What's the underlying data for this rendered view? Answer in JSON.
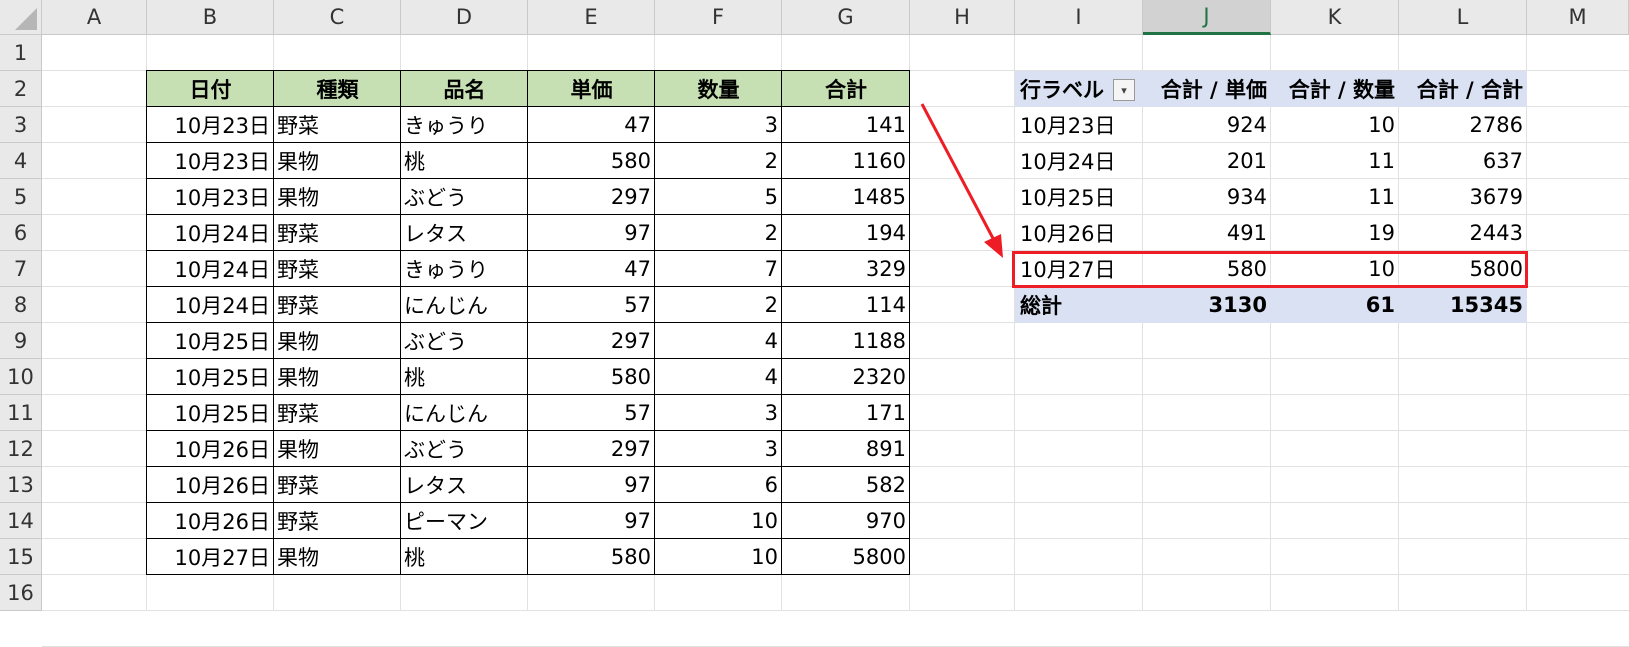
{
  "columns": [
    "A",
    "B",
    "C",
    "D",
    "E",
    "F",
    "G",
    "H",
    "I",
    "J",
    "K",
    "L",
    "M"
  ],
  "selected_column": "J",
  "rows": [
    "1",
    "2",
    "3",
    "4",
    "5",
    "6",
    "7",
    "8",
    "9",
    "10",
    "11",
    "12",
    "13",
    "14",
    "15",
    "16"
  ],
  "source_table": {
    "headers": [
      "日付",
      "種類",
      "品名",
      "単価",
      "数量",
      "合計"
    ],
    "rows": [
      [
        "10月23日",
        "野菜",
        "きゅうり",
        "47",
        "3",
        "141"
      ],
      [
        "10月23日",
        "果物",
        "桃",
        "580",
        "2",
        "1160"
      ],
      [
        "10月23日",
        "果物",
        "ぶどう",
        "297",
        "5",
        "1485"
      ],
      [
        "10月24日",
        "野菜",
        "レタス",
        "97",
        "2",
        "194"
      ],
      [
        "10月24日",
        "野菜",
        "きゅうり",
        "47",
        "7",
        "329"
      ],
      [
        "10月24日",
        "野菜",
        "にんじん",
        "57",
        "2",
        "114"
      ],
      [
        "10月25日",
        "果物",
        "ぶどう",
        "297",
        "4",
        "1188"
      ],
      [
        "10月25日",
        "果物",
        "桃",
        "580",
        "4",
        "2320"
      ],
      [
        "10月25日",
        "野菜",
        "にんじん",
        "57",
        "3",
        "171"
      ],
      [
        "10月26日",
        "果物",
        "ぶどう",
        "297",
        "3",
        "891"
      ],
      [
        "10月26日",
        "野菜",
        "レタス",
        "97",
        "6",
        "582"
      ],
      [
        "10月26日",
        "野菜",
        "ピーマン",
        "97",
        "10",
        "970"
      ],
      [
        "10月27日",
        "果物",
        "桃",
        "580",
        "10",
        "5800"
      ]
    ]
  },
  "pivot_table": {
    "headers": [
      "行ラベル",
      "合計 / 単価",
      "合計 / 数量",
      "合計 / 合計"
    ],
    "filter_icon": "dropdown-arrow-icon",
    "rows": [
      [
        "10月23日",
        "924",
        "10",
        "2786"
      ],
      [
        "10月24日",
        "201",
        "11",
        "637"
      ],
      [
        "10月25日",
        "934",
        "11",
        "3679"
      ],
      [
        "10月26日",
        "491",
        "19",
        "2443"
      ],
      [
        "10月27日",
        "580",
        "10",
        "5800"
      ]
    ],
    "total": [
      "総計",
      "3130",
      "61",
      "15345"
    ],
    "highlighted_row": "10月27日"
  },
  "colors": {
    "source_header_bg": "#c6e0b4",
    "pivot_header_bg": "#d9e1f2",
    "highlight": "#ee1c25",
    "selected_col_accent": "#217346"
  }
}
